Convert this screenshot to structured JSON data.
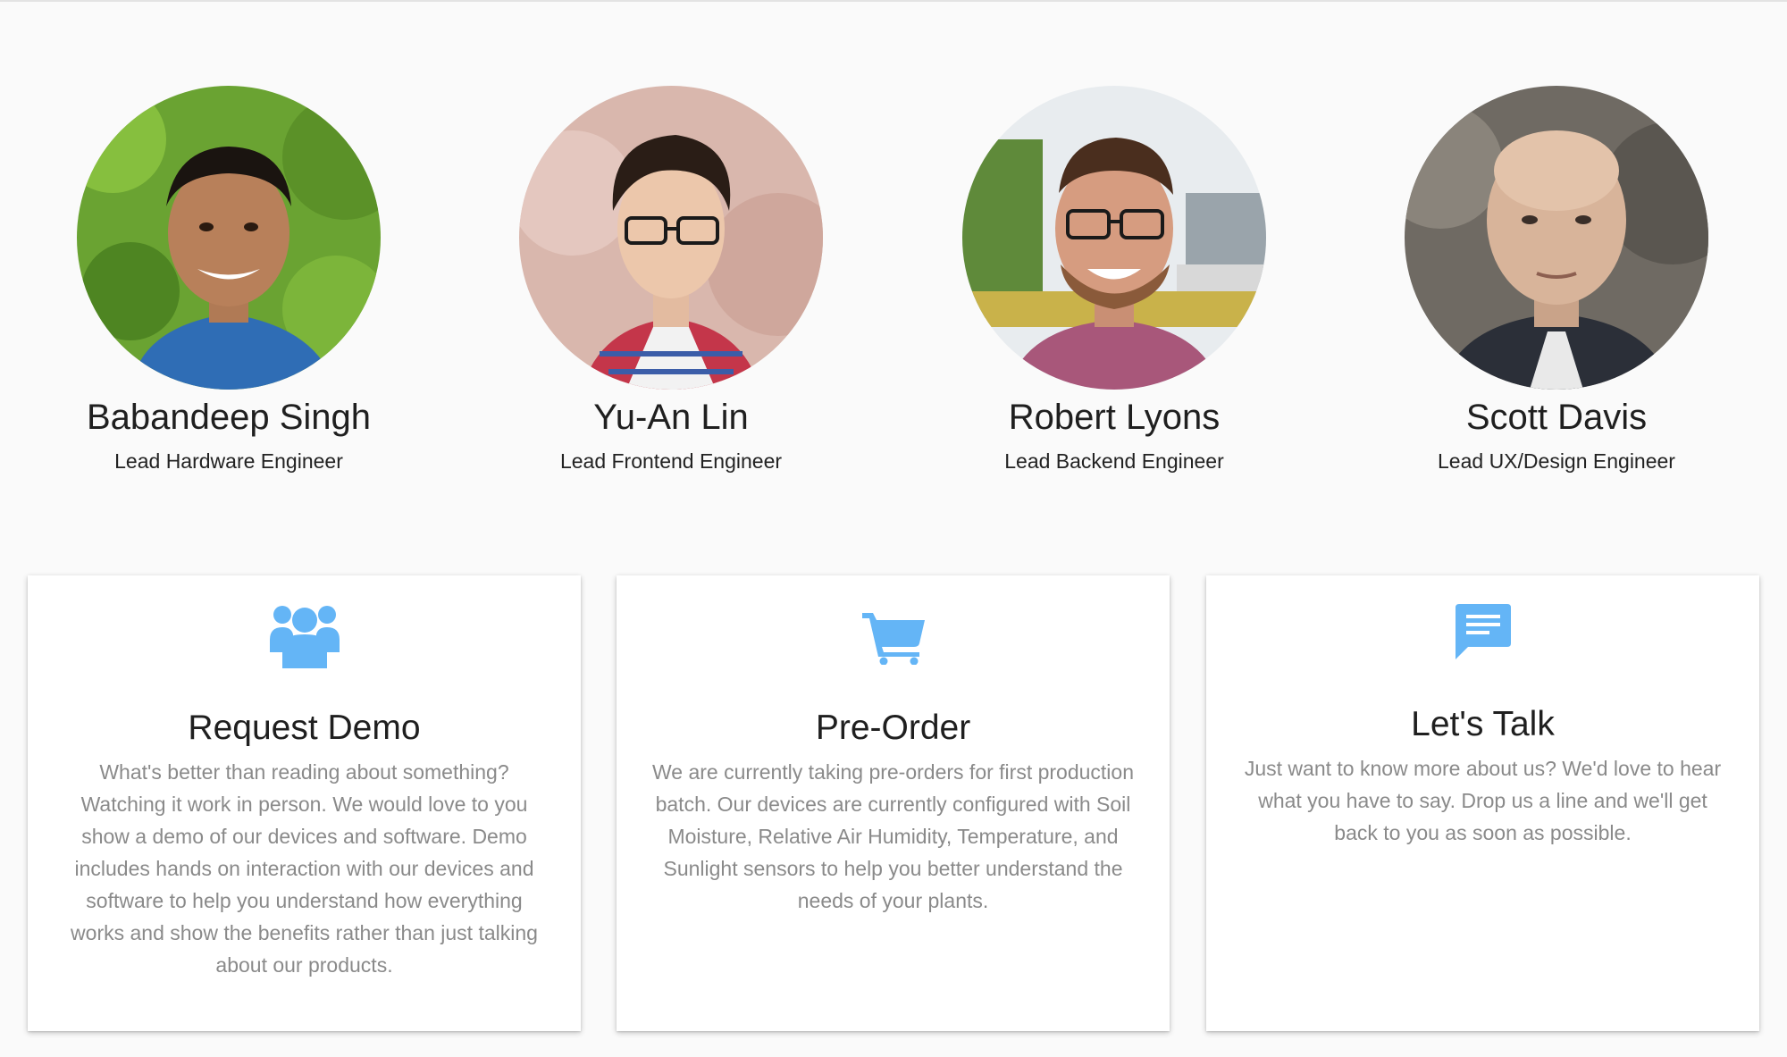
{
  "team": {
    "members": [
      {
        "name": "Babandeep Singh",
        "role": "Lead Hardware Engineer"
      },
      {
        "name": "Yu-An Lin",
        "role": "Lead Frontend Engineer"
      },
      {
        "name": "Robert Lyons",
        "role": "Lead Backend Engineer"
      },
      {
        "name": "Scott Davis",
        "role": "Lead UX/Design Engineer"
      }
    ]
  },
  "cards": [
    {
      "icon": "group-icon",
      "title": "Request Demo",
      "text": "What's better than reading about something? Watching it work in person. We would love to you show a demo of our devices and software. Demo includes hands on interaction with our devices and software to help you understand how everything works and show the benefits rather than just talking about our products."
    },
    {
      "icon": "shopping-cart-icon",
      "title": "Pre-Order",
      "text": "We are currently taking pre-orders for first production batch. Our devices are currently configured with Soil Moisture, Relative Air Humidity, Temperature, and Sunlight sensors to help you better understand the needs of your plants."
    },
    {
      "icon": "chat-message-icon",
      "title": "Let's Talk",
      "text": "Just want to know more about us? We'd love to hear what you have to say. Drop us a line and we'll get back to you as soon as possible."
    }
  ],
  "colors": {
    "background": "#fafafa",
    "accent_icon": "#64b5f6",
    "body_text": "#8a8a8a",
    "heading_text": "#1f1f1f"
  }
}
